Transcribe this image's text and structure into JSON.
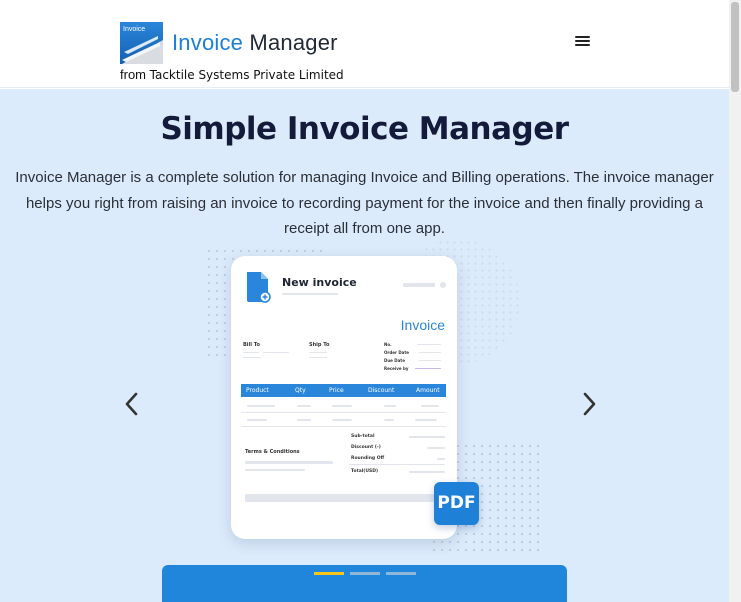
{
  "header": {
    "logo_icon_text": "Invoice",
    "brand_part1": "Invoice",
    "brand_part2": "Manager",
    "from_label": "from",
    "company": "Tacktile Systems Private Limited",
    "menu_icon": "hamburger-menu-icon"
  },
  "hero": {
    "title": "Simple Invoice Manager",
    "description": "Invoice Manager is a complete solution for managing Invoice and Billing operations. The invoice manager helps you right from raising an invoice to recording payment for the invoice and then finally providing a receipt all from one app.",
    "prev_icon": "chevron-left-icon",
    "next_icon": "chevron-right-icon"
  },
  "invoice_card": {
    "header_title": "New invoice",
    "invoice_word": "Invoice",
    "bill_to": "Bill To",
    "ship_to": "Ship To",
    "meta_labels": [
      "No.",
      "Order Date",
      "Due Date",
      "Receive by"
    ],
    "columns": [
      "Product",
      "Qty",
      "Price",
      "Discount",
      "Amount"
    ],
    "currency_symbol": "$",
    "totals_labels": [
      "Sub-total",
      "Discount (-)",
      "Rounding Off",
      "Total(USD)"
    ],
    "terms": "Terms & Conditions",
    "pdf_badge": "PDF"
  },
  "carousel": {
    "slide_count": 3,
    "active_index": 0
  },
  "colors": {
    "brand_blue": "#1a7fd8",
    "hero_bg": "#dcebfb",
    "panel_blue": "#1f86db",
    "indicator_active": "#f5c518",
    "indicator_inactive": "#8fb7d8"
  }
}
